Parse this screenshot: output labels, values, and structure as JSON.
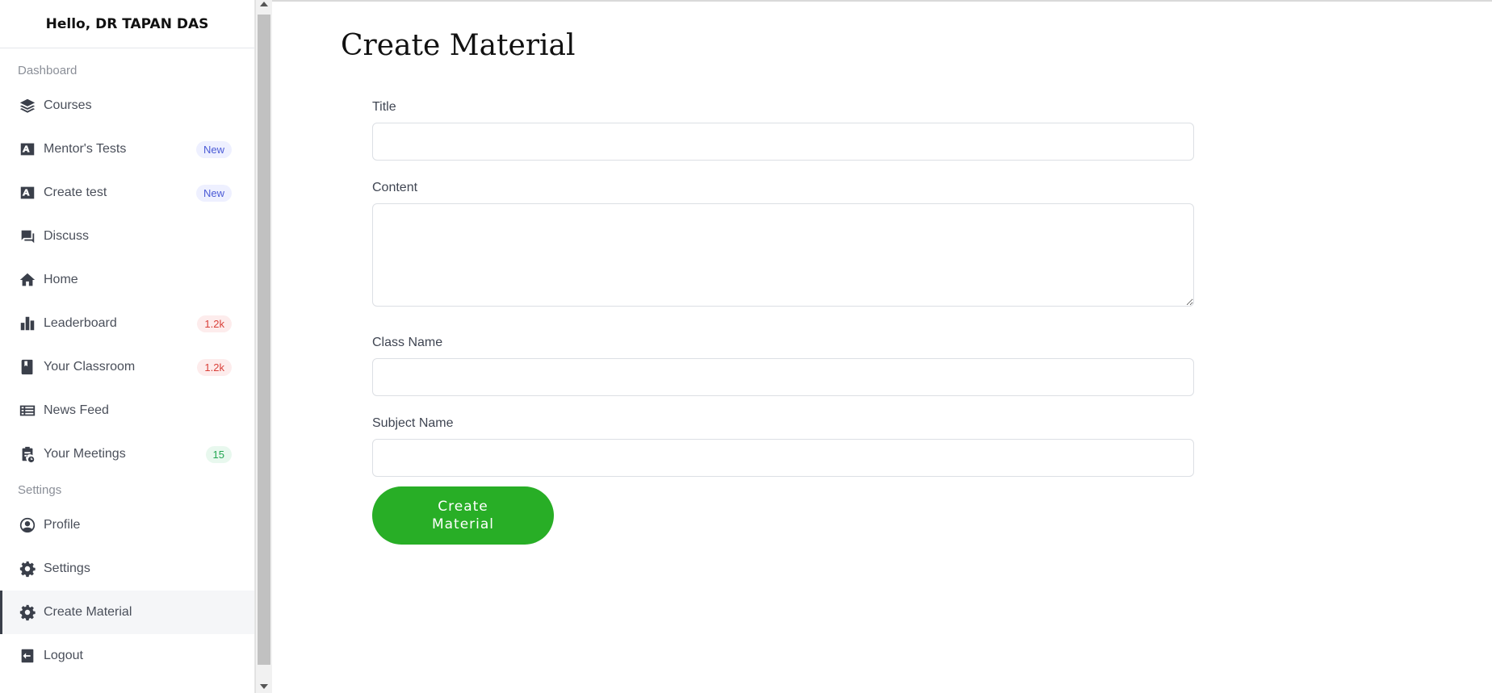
{
  "sidebar": {
    "greeting": "Hello, DR TAPAN DAS",
    "sections": {
      "dashboard_label": "Dashboard",
      "settings_label": "Settings"
    },
    "items": [
      {
        "label": "Courses",
        "icon": "stack-icon"
      },
      {
        "label": "Mentor's Tests",
        "icon": "grade-icon",
        "badge": "New"
      },
      {
        "label": "Create test",
        "icon": "grade-icon",
        "badge": "New"
      },
      {
        "label": "Discuss",
        "icon": "forum-icon"
      },
      {
        "label": "Home",
        "icon": "home-icon"
      },
      {
        "label": "Leaderboard",
        "icon": "bar-chart-icon",
        "badge": "1.2k"
      },
      {
        "label": "Your Classroom",
        "icon": "book-icon",
        "badge": "1.2k"
      },
      {
        "label": "News Feed",
        "icon": "news-icon"
      },
      {
        "label": "Your Meetings",
        "icon": "clipboard-icon",
        "badge": "15"
      },
      {
        "label": "Profile",
        "icon": "user-circle-icon"
      },
      {
        "label": "Settings",
        "icon": "gear-icon"
      },
      {
        "label": "Create Material",
        "icon": "gear-icon",
        "active": true
      },
      {
        "label": "Logout",
        "icon": "logout-icon"
      }
    ]
  },
  "page": {
    "title": "Create Material"
  },
  "form": {
    "title_label": "Title",
    "title_value": "",
    "content_label": "Content",
    "content_value": "",
    "class_label": "Class Name",
    "class_value": "",
    "subject_label": "Subject Name",
    "subject_value": "",
    "submit_label": "Create Material"
  },
  "colors": {
    "primary_button": "#28ae26",
    "badge_new": "#4b5bd6",
    "badge_count_red": "#d9413a",
    "badge_count_green": "#22a651"
  }
}
